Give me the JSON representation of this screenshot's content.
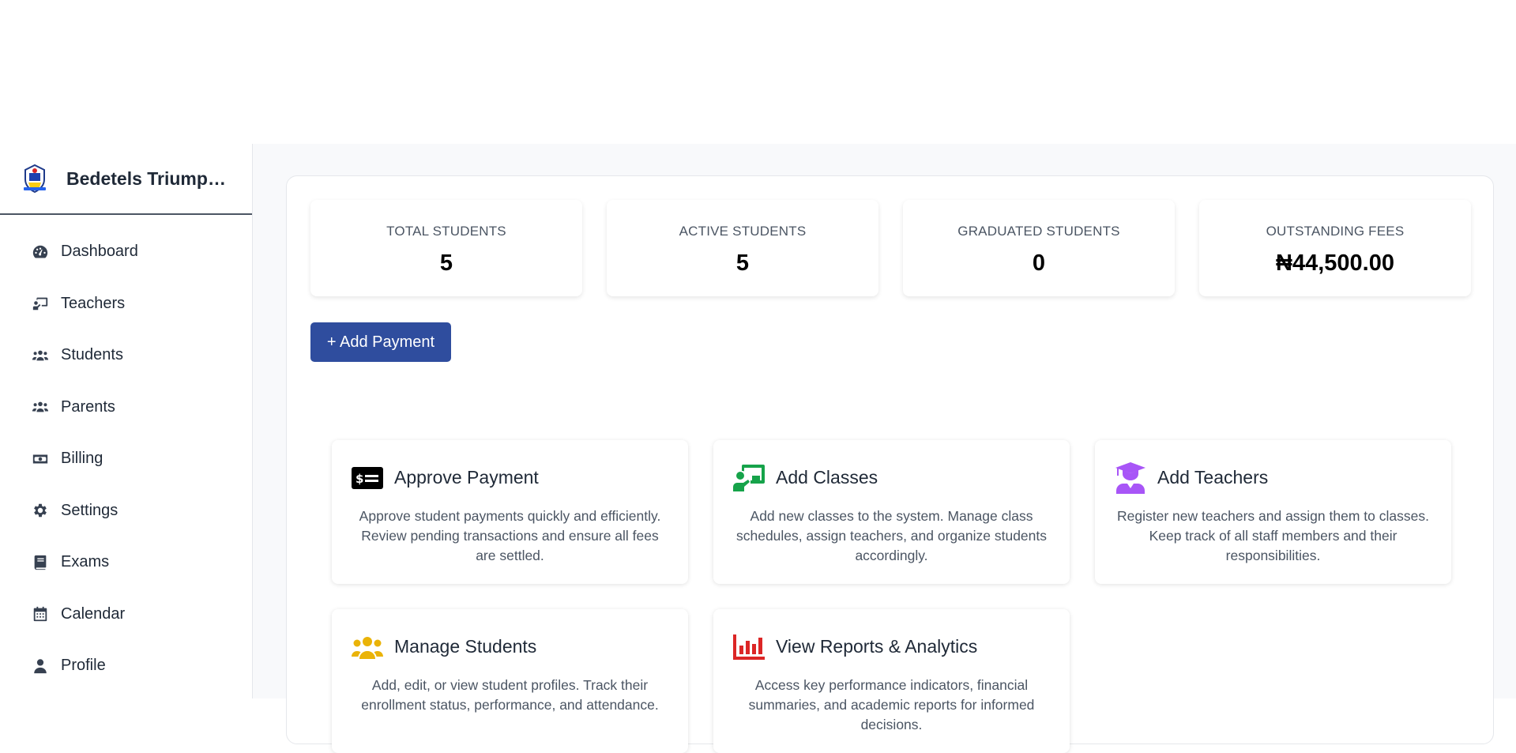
{
  "sidebar": {
    "brand_name": "Bedetels Triumph...",
    "items": [
      {
        "label": "Dashboard",
        "icon": "gauge-icon"
      },
      {
        "label": "Teachers",
        "icon": "chalkboard-teacher-icon"
      },
      {
        "label": "Students",
        "icon": "users-icon"
      },
      {
        "label": "Parents",
        "icon": "users-icon"
      },
      {
        "label": "Billing",
        "icon": "money-bill-icon"
      },
      {
        "label": "Settings",
        "icon": "gear-icon"
      },
      {
        "label": "Exams",
        "icon": "book-icon"
      },
      {
        "label": "Calendar",
        "icon": "calendar-icon"
      },
      {
        "label": "Profile",
        "icon": "user-icon"
      }
    ]
  },
  "stats": [
    {
      "label": "TOTAL STUDENTS",
      "value": "5"
    },
    {
      "label": "ACTIVE STUDENTS",
      "value": "5"
    },
    {
      "label": "GRADUATED STUDENTS",
      "value": "0"
    },
    {
      "label": "OUTSTANDING FEES",
      "value": "₦44,500.00"
    }
  ],
  "add_payment_label": "+ Add Payment",
  "cards": [
    {
      "title": "Approve Payment",
      "icon": "money-check-icon",
      "icon_color": "#000000",
      "desc": "Approve student payments quickly and efficiently. Review pending transactions and ensure all fees are settled."
    },
    {
      "title": "Add Classes",
      "icon": "chalkboard-user-icon",
      "icon_color": "#16a34a",
      "desc": "Add new classes to the system. Manage class schedules, assign teachers, and organize students accordingly."
    },
    {
      "title": "Add Teachers",
      "icon": "graduate-icon",
      "icon_color": "#a855f7",
      "desc": "Register new teachers and assign them to classes. Keep track of all staff members and their responsibilities."
    },
    {
      "title": "Manage Students",
      "icon": "users-icon",
      "icon_color": "#eab308",
      "desc": "Add, edit, or view student profiles. Track their enrollment status, performance, and attendance."
    },
    {
      "title": "View Reports & Analytics",
      "icon": "chart-bar-icon",
      "icon_color": "#dc2626",
      "desc": "Access key performance indicators, financial summaries, and academic reports for informed decisions."
    }
  ]
}
